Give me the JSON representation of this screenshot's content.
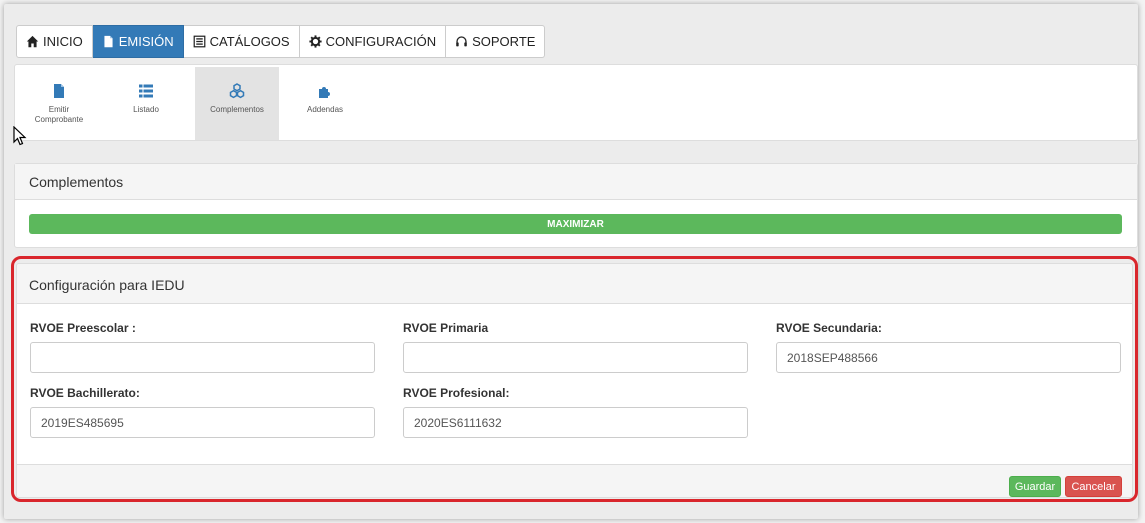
{
  "tabs": [
    {
      "label": "INICIO",
      "icon": "home-icon"
    },
    {
      "label": "EMISIÓN",
      "icon": "file-icon"
    },
    {
      "label": "CATÁLOGOS",
      "icon": "list-box-icon"
    },
    {
      "label": "CONFIGURACIÓN",
      "icon": "gear-icon"
    },
    {
      "label": "SOPORTE",
      "icon": "headset-icon"
    }
  ],
  "subnav": {
    "items": [
      {
        "label_line1": "Emitir",
        "label_line2": "Comprobante",
        "icon": "file-icon"
      },
      {
        "label_line1": "Listado",
        "label_line2": "",
        "icon": "list-icon"
      },
      {
        "label_line1": "Complementos",
        "label_line2": "",
        "icon": "cubes-icon"
      },
      {
        "label_line1": "Addendas",
        "label_line2": "",
        "icon": "puzzle-icon"
      }
    ]
  },
  "complementos": {
    "title": "Complementos",
    "maximize_label": "MAXIMIZAR"
  },
  "iedu": {
    "title": "Configuración para IEDU",
    "fields": {
      "preescolar": {
        "label": "RVOE Preescolar :",
        "value": ""
      },
      "primaria": {
        "label": "RVOE Primaria",
        "value": ""
      },
      "secundaria": {
        "label": "RVOE Secundaria:",
        "value": "2018SEP488566"
      },
      "bachillerato": {
        "label": "RVOE Bachillerato:",
        "value": "2019ES485695"
      },
      "profesional": {
        "label": "RVOE Profesional:",
        "value": "2020ES6111632"
      }
    },
    "save_label": "Guardar",
    "cancel_label": "Cancelar"
  },
  "colors": {
    "primary": "#337ab7",
    "success": "#5cb85c",
    "danger": "#d9534f",
    "highlight": "#d9262c"
  }
}
